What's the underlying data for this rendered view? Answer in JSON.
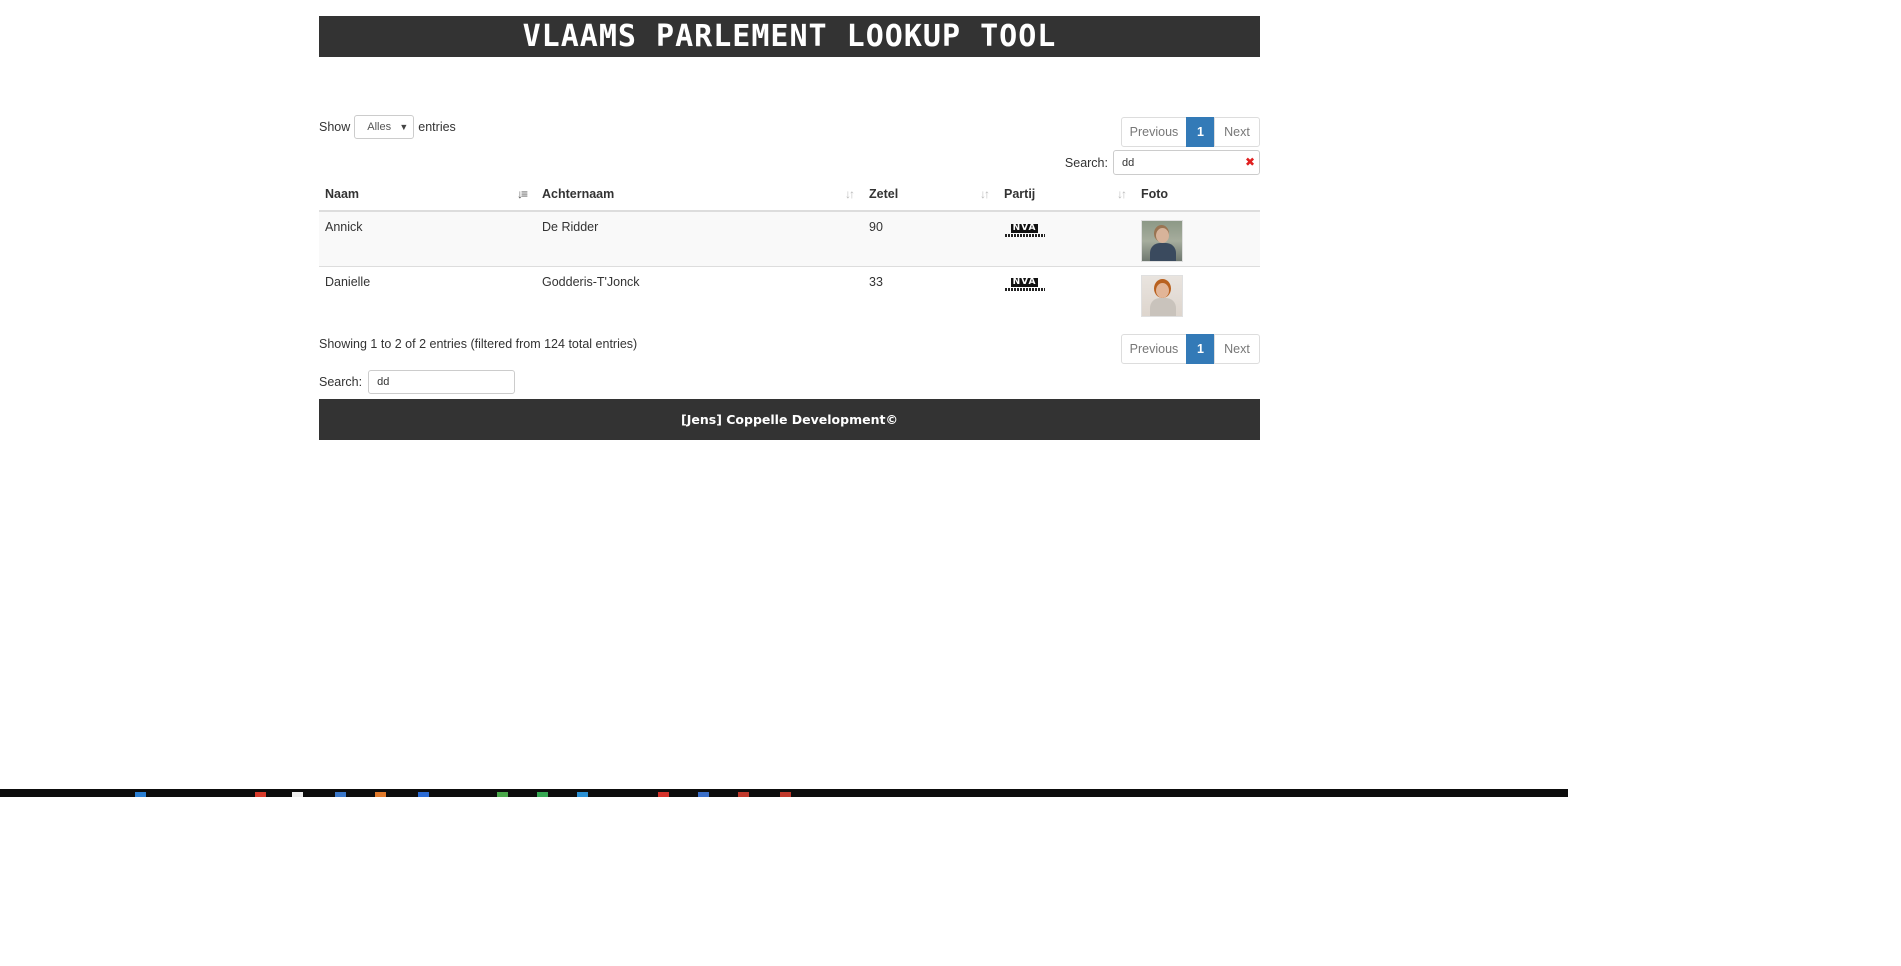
{
  "header": {
    "title": "Vlaams Parlement Lookup Tool"
  },
  "length_menu": {
    "prefix": "Show",
    "selected": "Alles",
    "suffix": "entries"
  },
  "pagination": {
    "previous": "Previous",
    "current_page": "1",
    "next": "Next"
  },
  "search": {
    "label": "Search:",
    "value": "dd"
  },
  "table": {
    "columns": [
      "Naam",
      "Achternaam",
      "Zetel",
      "Partij",
      "Foto"
    ],
    "rows": [
      {
        "naam": "Annick",
        "achternaam": "De Ridder",
        "zetel": "90",
        "partij_logo": "NVA"
      },
      {
        "naam": "Danielle",
        "achternaam": "Godderis-T'Jonck",
        "zetel": "33",
        "partij_logo": "NVA"
      }
    ]
  },
  "info": "Showing 1 to 2 of 2 entries (filtered from 124 total entries)",
  "footer": {
    "text": "[Jens] Coppelle Development©"
  },
  "colors": {
    "bar": "#333333",
    "accent": "#337ab7",
    "clear": "#e02020"
  },
  "icons": {
    "sort": "sort-arrows-icon",
    "clear": "clear-x-icon",
    "dropdown": "caret-down-icon"
  }
}
